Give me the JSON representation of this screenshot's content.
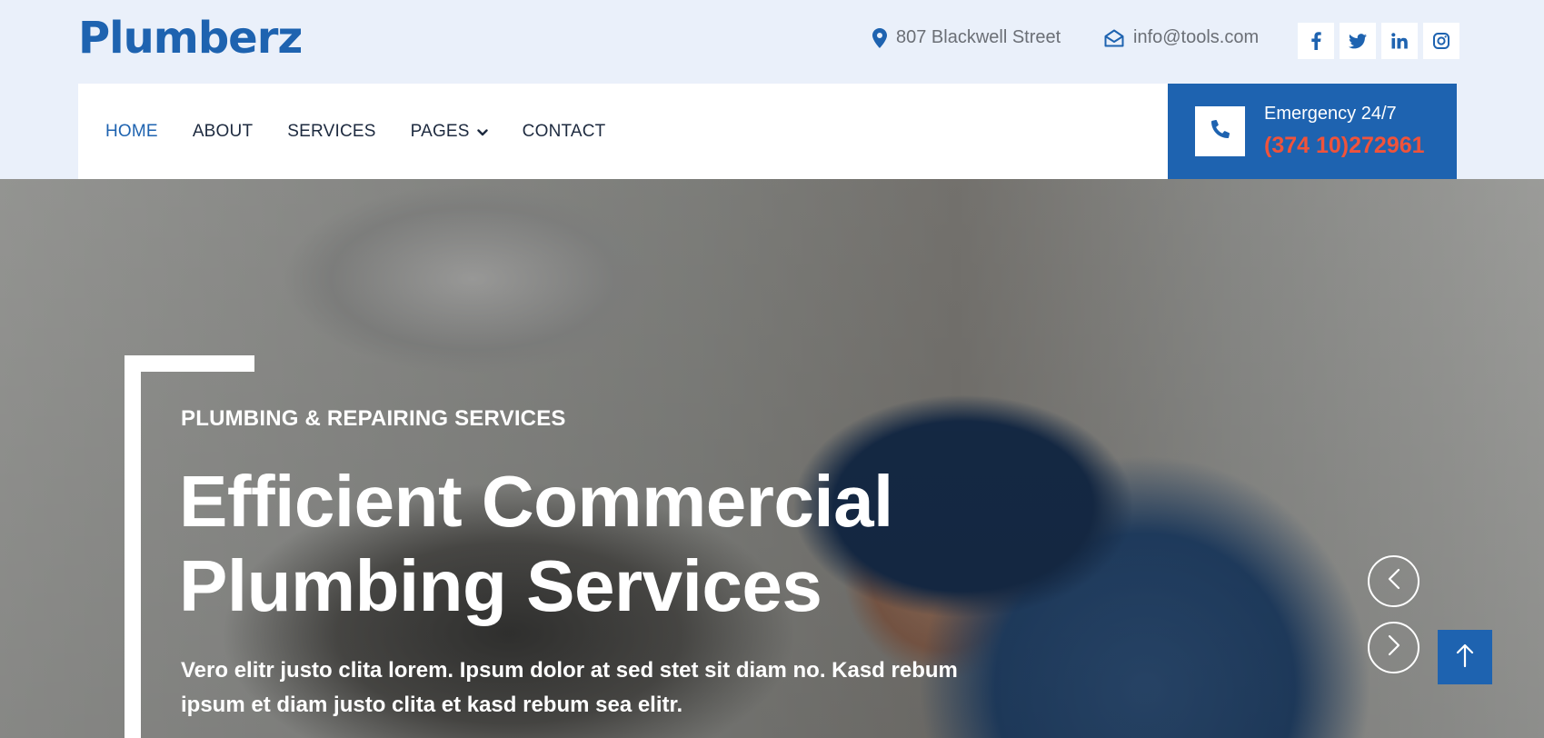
{
  "brand": {
    "name": "Plumberz"
  },
  "topbar": {
    "address": "807 Blackwell Street",
    "email": "info@tools.com",
    "socials": [
      {
        "icon": "facebook-icon"
      },
      {
        "icon": "twitter-icon"
      },
      {
        "icon": "linkedin-icon"
      },
      {
        "icon": "instagram-icon"
      }
    ]
  },
  "nav": {
    "items": [
      {
        "label": "HOME",
        "active": true
      },
      {
        "label": "ABOUT"
      },
      {
        "label": "SERVICES"
      },
      {
        "label": "PAGES",
        "has_dropdown": true
      },
      {
        "label": "CONTACT"
      }
    ]
  },
  "emergency": {
    "label": "Emergency 24/7",
    "phone": "(374 10)272961",
    "icon": "phone-icon"
  },
  "hero": {
    "subtitle": "PLUMBING & REPAIRING SERVICES",
    "title_line1": "Efficient Commercial",
    "title_line2": "Plumbing Services",
    "text": "Vero elitr justo clita lorem. Ipsum dolor at sed stet sit diam no. Kasd rebum ipsum et diam justo clita et kasd rebum sea elitr."
  },
  "colors": {
    "brand": "#1e63b0",
    "accent_phone": "#f0533b",
    "topbar_bg": "#eaf0fa",
    "nav_text": "#1d2a3f"
  }
}
